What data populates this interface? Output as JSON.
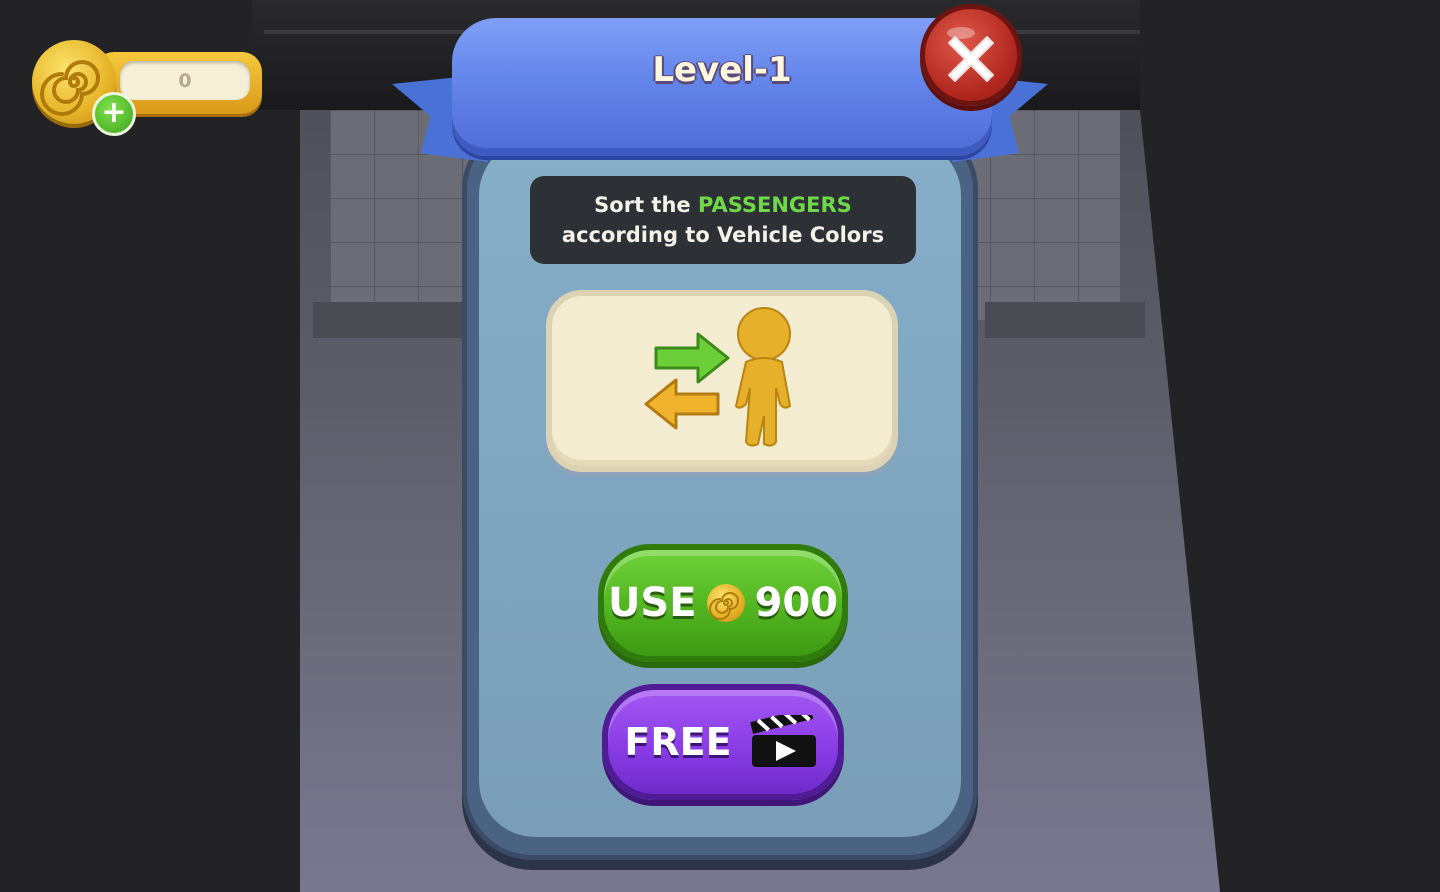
{
  "hud": {
    "coin_balance": "0",
    "coin_icon": "spiral-coin-icon",
    "add_icon": "plus-icon",
    "add_symbol": "+"
  },
  "modal": {
    "title": "Level-1",
    "close_icon": "close-icon",
    "instruction": {
      "prefix": "Sort the ",
      "highlight": "PASSENGERS",
      "line2": "according to Vehicle Colors"
    },
    "card_icon": "swap-passenger-icon",
    "use_button": {
      "label": "USE",
      "cost": "900",
      "coin_icon": "spiral-coin-icon"
    },
    "free_button": {
      "label": "FREE",
      "video_icon": "clapperboard-video-icon"
    }
  },
  "colors": {
    "ribbon": "#6485ea",
    "use_button": "#4fb21e",
    "free_button": "#8a3de6",
    "close_button": "#b2281f",
    "highlight_text": "#6fd84a",
    "coin": "#e7b428"
  }
}
